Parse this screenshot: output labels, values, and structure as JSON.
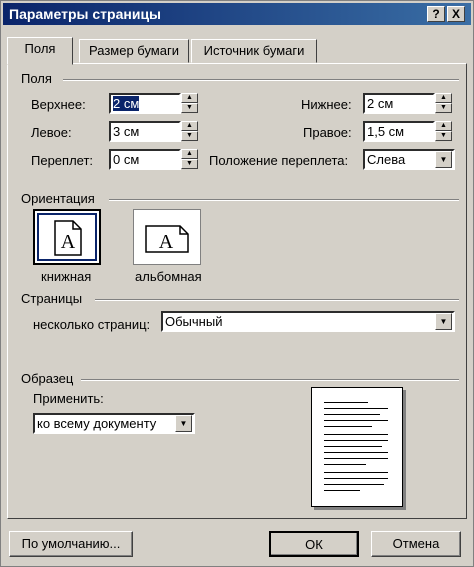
{
  "window": {
    "title": "Параметры страницы",
    "help_button": "?",
    "close_button": "X"
  },
  "tabs": [
    {
      "label": "Поля",
      "active": true
    },
    {
      "label": "Размер бумаги",
      "active": false
    },
    {
      "label": "Источник бумаги",
      "active": false
    }
  ],
  "margins": {
    "group_label": "Поля",
    "top": {
      "label": "Верхнее:",
      "value": "2 см"
    },
    "bottom": {
      "label": "Нижнее:",
      "value": "2 см"
    },
    "left": {
      "label": "Левое:",
      "value": "3 см"
    },
    "right": {
      "label": "Правое:",
      "value": "1,5 см"
    },
    "gutter": {
      "label": "Переплет:",
      "value": "0 см"
    },
    "gutter_position": {
      "label": "Положение переплета:",
      "value": "Слева"
    }
  },
  "orientation": {
    "group_label": "Ориентация",
    "portrait": {
      "label": "книжная",
      "glyph": "A",
      "selected": true
    },
    "landscape": {
      "label": "альбомная",
      "glyph": "A",
      "selected": false
    }
  },
  "pages": {
    "group_label": "Страницы",
    "multiple_label": "несколько страниц:",
    "multiple_value": "Обычный"
  },
  "preview": {
    "group_label": "Образец",
    "apply_label": "Применить:",
    "apply_value": "ко всему документу"
  },
  "footer": {
    "default_button": "По умолчанию...",
    "ok_button": "ОК",
    "cancel_button": "Отмена"
  },
  "icons": {
    "spin_up": "▲",
    "spin_down": "▼",
    "dropdown": "▼"
  }
}
